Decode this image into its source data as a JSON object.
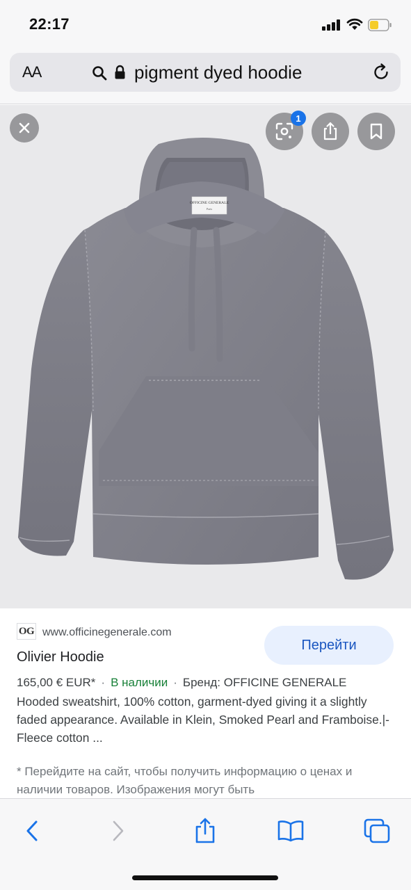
{
  "status_bar": {
    "time": "22:17"
  },
  "address_bar": {
    "text_size_label": "AA",
    "query": "pigment dyed hoodie"
  },
  "image_viewer": {
    "lens_badge_count": "1",
    "tag_brand": "OFFICINE GENERALE",
    "tag_sub": "Paris",
    "icons": [
      "close-icon",
      "lens-icon",
      "share-icon",
      "bookmark-icon"
    ]
  },
  "result": {
    "site_logo": "OG",
    "site_url": "www.officinegenerale.com",
    "visit_label": "Перейти",
    "title": "Olivier Hoodie",
    "price": "165,00 € EUR*",
    "stock": "В наличии",
    "brand": "Бренд: OFFICINE GENERALE",
    "description": "Hooded sweatshirt, 100% cotton, garment-dyed giving it a slightly faded appearance. Available in Klein, Smoked Pearl and Framboise.|- Fleece cotton ...",
    "disclaimer": "* Перейдите на сайт, чтобы получить информацию о ценах и наличии товаров. Изображения могут быть"
  },
  "toolbar": {
    "icons": [
      "back-icon",
      "forward-icon",
      "share-icon",
      "bookmarks-icon",
      "tabs-icon"
    ]
  },
  "colors": {
    "accent": "#1a73e8",
    "stock_green": "#188038",
    "hoodie_grey": "#7f7f88"
  }
}
